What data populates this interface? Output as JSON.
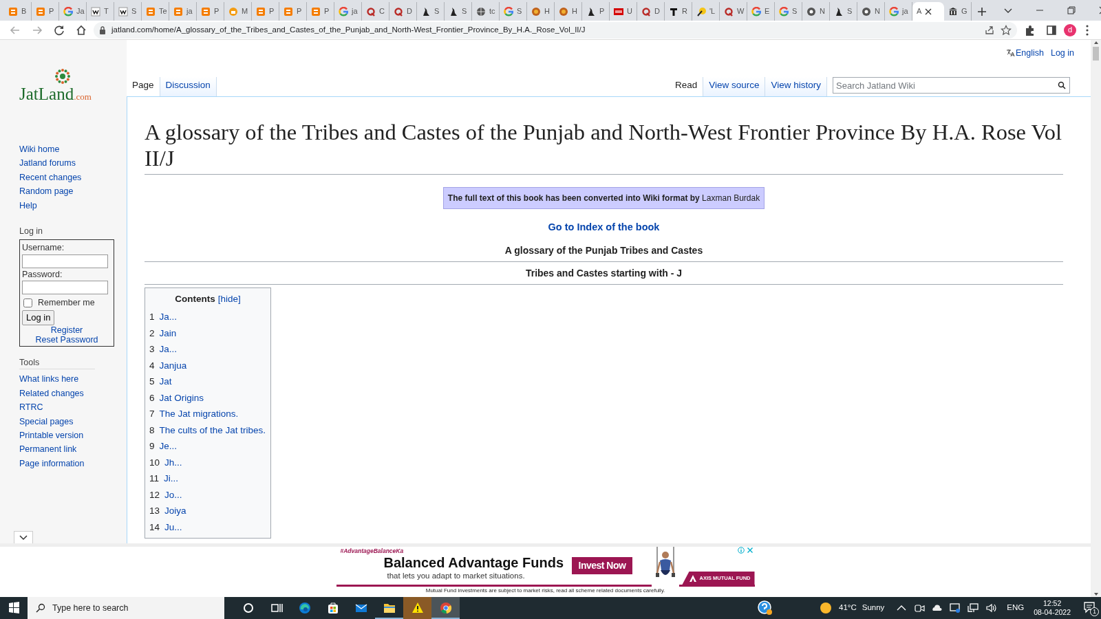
{
  "browser": {
    "tabs": [
      {
        "kind": "blogger",
        "title": "B",
        "selected": false
      },
      {
        "kind": "blogger",
        "title": "P",
        "selected": false
      },
      {
        "kind": "google",
        "title": "Ja",
        "selected": false
      },
      {
        "kind": "wiki",
        "title": "T",
        "selected": false
      },
      {
        "kind": "wiki",
        "title": "S",
        "selected": false
      },
      {
        "kind": "blogger",
        "title": "Te",
        "selected": false
      },
      {
        "kind": "blogger",
        "title": "ja",
        "selected": false
      },
      {
        "kind": "blogger",
        "title": "P",
        "selected": false
      },
      {
        "kind": "orange",
        "title": "M",
        "selected": false
      },
      {
        "kind": "blogger",
        "title": "P",
        "selected": false
      },
      {
        "kind": "blogger",
        "title": "P",
        "selected": false
      },
      {
        "kind": "blogger",
        "title": "P",
        "selected": false
      },
      {
        "kind": "google",
        "title": "ja",
        "selected": false
      },
      {
        "kind": "quora",
        "title": "C",
        "selected": false
      },
      {
        "kind": "quora",
        "title": "D",
        "selected": false
      },
      {
        "kind": "bat",
        "title": "S",
        "selected": false
      },
      {
        "kind": "bat",
        "title": "S",
        "selected": false
      },
      {
        "kind": "globe",
        "title": "tc",
        "selected": false
      },
      {
        "kind": "google",
        "title": "S",
        "selected": false
      },
      {
        "kind": "food",
        "title": "H",
        "selected": false
      },
      {
        "kind": "food",
        "title": "H",
        "selected": false
      },
      {
        "kind": "bat",
        "title": "P",
        "selected": false
      },
      {
        "kind": "toi",
        "title": "U",
        "selected": false
      },
      {
        "kind": "quora",
        "title": "D",
        "selected": false
      },
      {
        "kind": "serif",
        "title": "R",
        "selected": false
      },
      {
        "kind": "feather",
        "title": "'L",
        "selected": false
      },
      {
        "kind": "quora",
        "title": "W",
        "selected": false
      },
      {
        "kind": "google",
        "title": "E",
        "selected": false
      },
      {
        "kind": "google",
        "title": "S",
        "selected": false
      },
      {
        "kind": "chrome",
        "title": "N",
        "selected": false
      },
      {
        "kind": "bat",
        "title": "S",
        "selected": false
      },
      {
        "kind": "chrome",
        "title": "N",
        "selected": false
      },
      {
        "kind": "google",
        "title": "ja",
        "selected": false
      },
      {
        "kind": "blank",
        "title": "A",
        "selected": true
      },
      {
        "kind": "pillar",
        "title": "G",
        "selected": false
      }
    ],
    "address": "jatland.com/home/A_glossary_of_the_Tribes_and_Castes_of_the_Punjab_and_North-West_Frontier_Province_By_H.A._Rose_Vol_II/J",
    "profile": "d"
  },
  "wiki": {
    "personal_links": [
      "English",
      "Log in"
    ],
    "logo": {
      "name": "JatLand",
      "suffix": ".com"
    },
    "page_tabs": [
      {
        "label": "Page",
        "selected": true
      },
      {
        "label": "Discussion",
        "selected": false
      }
    ],
    "view_tabs": [
      {
        "label": "Read",
        "selected": true
      },
      {
        "label": "View source",
        "selected": false
      },
      {
        "label": "View history",
        "selected": false
      }
    ],
    "search": {
      "placeholder": "Search Jatland Wiki"
    },
    "sidebar": {
      "navigation": [
        "Wiki home",
        "Jatland forums",
        "Recent changes",
        "Random page",
        "Help"
      ],
      "login": {
        "heading": "Log in",
        "username_label": "Username:",
        "password_label": "Password:",
        "remember": {
          "label": "Remember me",
          "checked": false
        },
        "button": "Log in",
        "links": [
          "Register",
          "Reset Password"
        ]
      },
      "tools": {
        "heading": "Tools",
        "items": [
          "What links here",
          "Related changes",
          "RTRC",
          "Special pages",
          "Printable version",
          "Permanent link",
          "Page information"
        ]
      }
    },
    "content": {
      "title": "A glossary of the Tribes and Castes of the Punjab and North-West Frontier Province By H.A. Rose Vol II/J",
      "notice": {
        "text": "The full text of this book has been converted into Wiki format by ",
        "link": "Laxman Burdak"
      },
      "index_link": "Go to Index of the book",
      "subtitle": "A glossary of the Punjab Tribes and Castes",
      "section_heading": "Tribes and Castes starting with - J",
      "toc": {
        "title": "Contents",
        "toggle": "[hide]",
        "items": [
          {
            "number": "1",
            "label": "Ja..."
          },
          {
            "number": "2",
            "label": "Jain"
          },
          {
            "number": "3",
            "label": "Ja..."
          },
          {
            "number": "4",
            "label": "Janjua"
          },
          {
            "number": "5",
            "label": "Jat"
          },
          {
            "number": "6",
            "label": "Jat Origins"
          },
          {
            "number": "7",
            "label": "The Jat migrations."
          },
          {
            "number": "8",
            "label": "The cults of the Jat tribes."
          },
          {
            "number": "9",
            "label": "Je..."
          },
          {
            "number": "10",
            "label": "Jh..."
          },
          {
            "number": "11",
            "label": "Ji..."
          },
          {
            "number": "12",
            "label": "Jo..."
          },
          {
            "number": "13",
            "label": "Joiya"
          },
          {
            "number": "14",
            "label": "Ju..."
          }
        ]
      }
    }
  },
  "ad": {
    "hashtag": "#AdvantageBalanceKa",
    "headline": "Balanced Advantage Funds",
    "subline": "that lets you adapt to market situations.",
    "cta": "Invest Now",
    "brand": "AXIS MUTUAL FUND",
    "disclaimer": "Mutual Fund investments are subject to market risks, read all scheme related documents carefully."
  },
  "taskbar": {
    "search_placeholder": "Type here to search",
    "apps": [
      {
        "kind": "cortana",
        "running": false,
        "selected": false,
        "flashing": false
      },
      {
        "kind": "taskview",
        "running": false,
        "selected": false,
        "flashing": false
      },
      {
        "kind": "edge",
        "running": false,
        "selected": false,
        "flashing": false
      },
      {
        "kind": "store",
        "running": false,
        "selected": false,
        "flashing": false
      },
      {
        "kind": "mail",
        "running": false,
        "selected": false,
        "flashing": false
      },
      {
        "kind": "explorer",
        "running": true,
        "selected": false,
        "flashing": false
      },
      {
        "kind": "warning",
        "running": false,
        "selected": false,
        "flashing": true
      },
      {
        "kind": "chrome",
        "running": true,
        "selected": true,
        "flashing": false
      }
    ],
    "weather": {
      "temp": "41°C",
      "condition": "Sunny"
    },
    "language": "ENG",
    "time": "12:52",
    "date": "08-04-2022",
    "notifications": "1"
  }
}
